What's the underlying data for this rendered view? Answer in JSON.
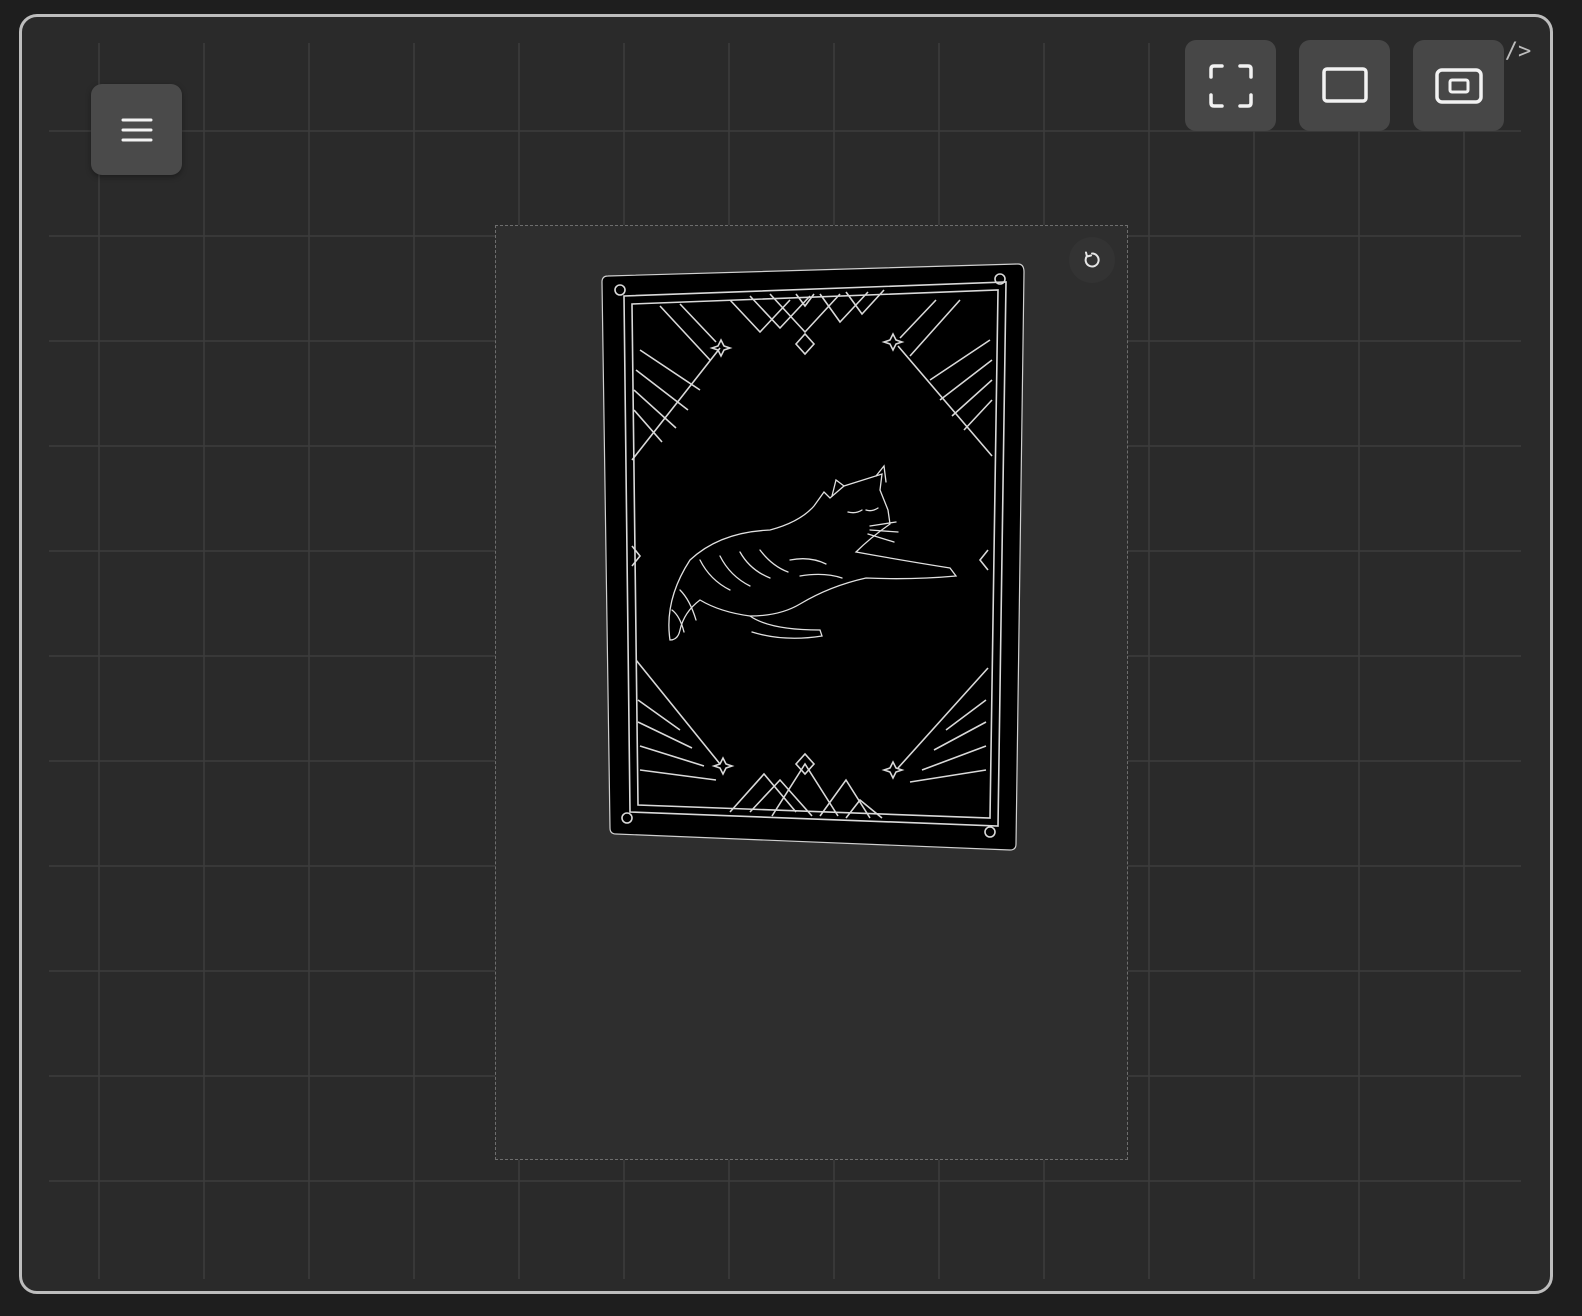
{
  "toolbar": {
    "menu_icon": "hamburger-menu-icon",
    "buttons": [
      {
        "name": "fullscreen",
        "icon": "fullscreen-corners-icon"
      },
      {
        "name": "frame-view",
        "icon": "rectangle-frame-icon"
      },
      {
        "name": "fit-view",
        "icon": "fit-screen-icon"
      }
    ],
    "code_toggle_label": "/>"
  },
  "canvas": {
    "reset_icon": "rotate-reset-icon",
    "card": {
      "subject": "reclining-cat-illustration",
      "style": "art-deco-tarot-card-back"
    }
  },
  "colors": {
    "background": "#2a2a2a",
    "frame_border": "#bdbdbd",
    "button": "#474747",
    "card": "#000000",
    "card_lines": "#d9d9d9"
  }
}
